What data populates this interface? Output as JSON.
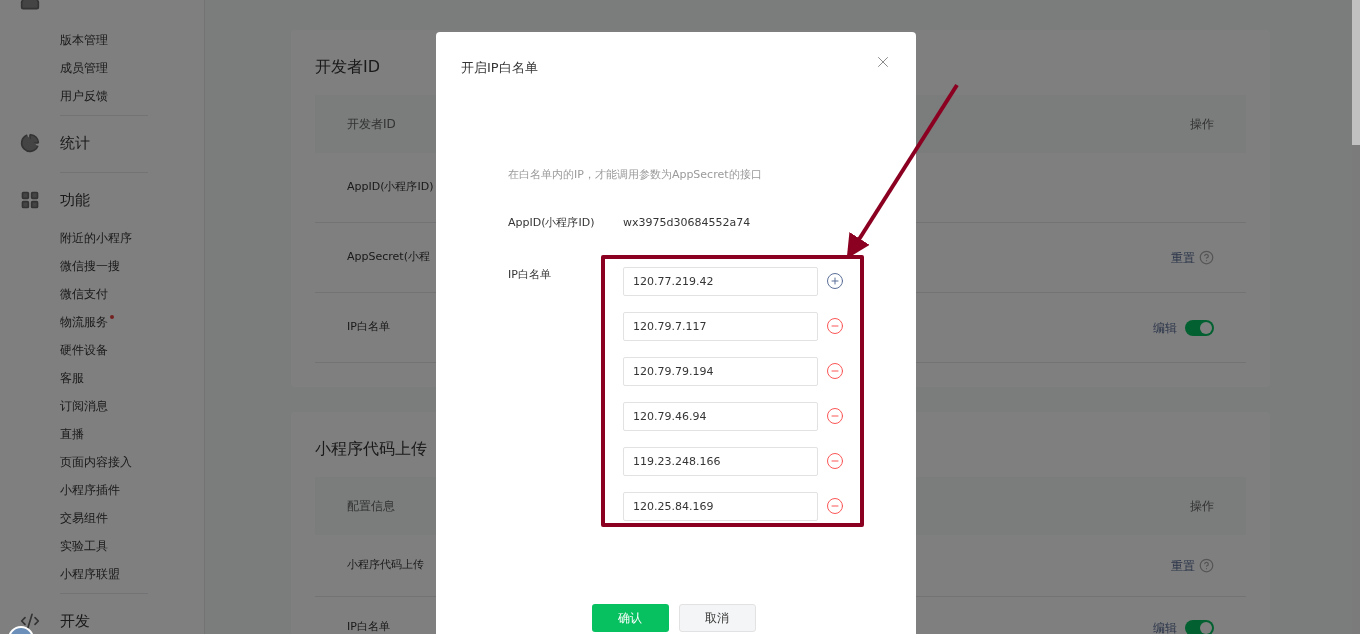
{
  "sidebar": {
    "sections": [
      {
        "items": [
          {
            "label": "版本管理",
            "dot": false
          },
          {
            "label": "成员管理",
            "dot": false
          },
          {
            "label": "用户反馈",
            "dot": false
          }
        ]
      },
      {
        "title": "统计"
      },
      {
        "title": "功能",
        "items": [
          {
            "label": "附近的小程序",
            "dot": false
          },
          {
            "label": "微信搜一搜",
            "dot": false
          },
          {
            "label": "微信支付",
            "dot": false
          },
          {
            "label": "物流服务",
            "dot": true
          },
          {
            "label": "硬件设备",
            "dot": false
          },
          {
            "label": "客服",
            "dot": false
          },
          {
            "label": "订阅消息",
            "dot": false
          },
          {
            "label": "直播",
            "dot": false
          },
          {
            "label": "页面内容接入",
            "dot": false
          },
          {
            "label": "小程序插件",
            "dot": false
          },
          {
            "label": "交易组件",
            "dot": false
          },
          {
            "label": "实验工具",
            "dot": false
          },
          {
            "label": "小程序联盟",
            "dot": false
          }
        ]
      },
      {
        "title": "开发"
      }
    ]
  },
  "cards": [
    {
      "title": "开发者ID",
      "columns": [
        "开发者ID",
        "操作"
      ],
      "rows": [
        {
          "label": "AppID(小程序ID)"
        },
        {
          "label": "AppSecret(小程",
          "action": {
            "kind": "link",
            "text": "重置"
          }
        },
        {
          "label": "IP白名单",
          "action": {
            "kind": "toggle",
            "text": "编辑",
            "on": true
          }
        }
      ]
    },
    {
      "title": "小程序代码上传",
      "columns": [
        "配置信息",
        "操作"
      ],
      "rows": [
        {
          "label": "小程序代码上传",
          "action": {
            "kind": "link",
            "text": "重置"
          }
        },
        {
          "label": "IP白名单",
          "action": {
            "kind": "toggle",
            "text": "编辑",
            "on": true
          }
        }
      ]
    }
  ],
  "dialog": {
    "title": "开启IP白名单",
    "hint": "在白名单内的IP，才能调用参数为AppSecret的接口",
    "app_id": {
      "label": "AppID(小程序ID)",
      "value": "wx3975d30684552a74"
    },
    "whitelist": {
      "label": "IP白名单",
      "entries": [
        {
          "value": "120.77.219.42",
          "kind": "add"
        },
        {
          "value": "120.79.7.117",
          "kind": "remove"
        },
        {
          "value": "120.79.79.194",
          "kind": "remove"
        },
        {
          "value": "120.79.46.94",
          "kind": "remove"
        },
        {
          "value": "119.23.248.166",
          "kind": "remove"
        },
        {
          "value": "120.25.84.169",
          "kind": "remove"
        }
      ]
    },
    "buttons": [
      {
        "label": "确认",
        "kind": "primary"
      },
      {
        "label": "取消",
        "kind": "default"
      }
    ]
  }
}
